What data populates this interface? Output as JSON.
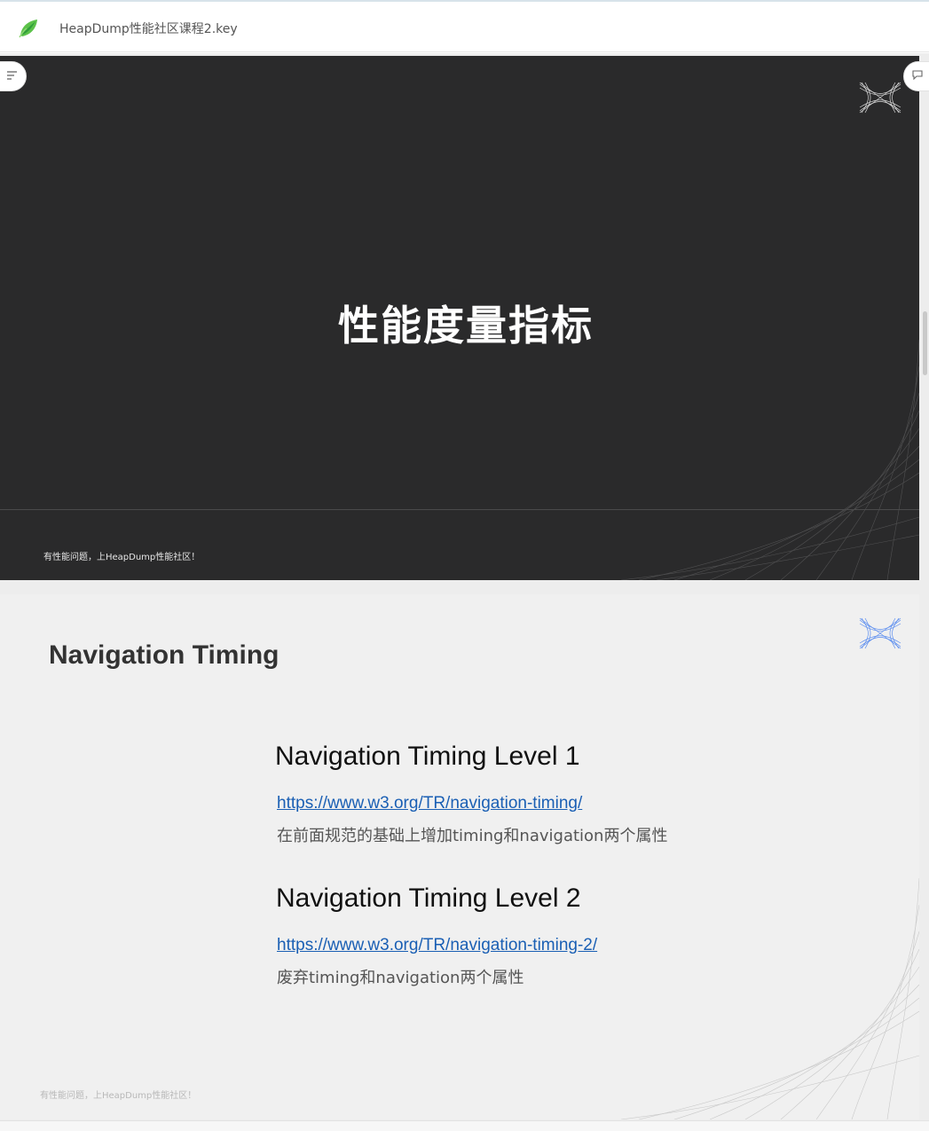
{
  "app": {
    "document_title": "HeapDump性能社区课程2.key",
    "logo_icon": "green-leaf-logo-icon"
  },
  "toolbar": {
    "outline_icon": "outline-list-icon",
    "comment_icon": "comment-icon"
  },
  "slides": [
    {
      "title": "性能度量指标",
      "footer": "有性能问题，上HeapDump性能社区！",
      "background": "#2a2a2b",
      "logo_icon": "hourglass-mesh-logo-icon"
    },
    {
      "heading": "Navigation Timing",
      "sections": [
        {
          "title": "Navigation Timing Level 1",
          "link": "https://www.w3.org/TR/navigation-timing/",
          "description": "在前面规范的基础上增加timing和navigation两个属性"
        },
        {
          "title": "Navigation Timing Level 2",
          "link": "https://www.w3.org/TR/navigation-timing-2/",
          "description": "废弃timing和navigation两个属性"
        }
      ],
      "footer": "有性能问题，上HeapDump性能社区！",
      "background": "#f0f0f0",
      "link_color": "#1a5fb4",
      "logo_icon": "hourglass-mesh-logo-icon"
    }
  ]
}
